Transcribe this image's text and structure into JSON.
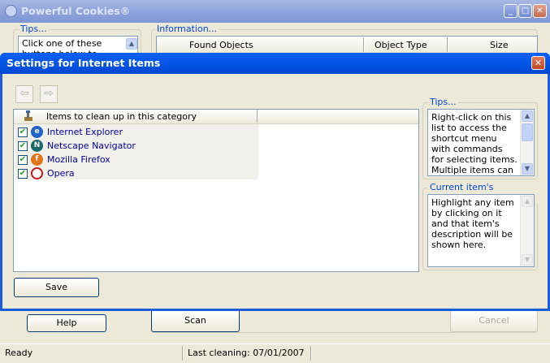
{
  "window": {
    "title": "Powerful Cookies®",
    "icon": "cookie-icon"
  },
  "caption_buttons": {
    "minimize": "_",
    "maximize": "□",
    "close": "✕"
  },
  "main": {
    "tips_label": "Tips...",
    "tips_text": "Click one of these buttons below to",
    "info_label": "Information...",
    "columns": [
      "Found Objects",
      "Object Type",
      "Size"
    ],
    "help_button": "Help",
    "scan_button": "Scan",
    "cancel_button": "Cancel"
  },
  "status": {
    "ready": "Ready",
    "last_cleaning": "Last cleaning: 07/01/2007"
  },
  "dialog": {
    "title": "Settings for Internet Items",
    "close": "✕",
    "back_icon": "arrow-left-icon",
    "forward_icon": "arrow-right-icon",
    "list_header": "Items to clean up in this category",
    "items": [
      {
        "label": "Internet Explorer",
        "checked": true,
        "icon": "internet-explorer-icon",
        "color": "#1f62c8"
      },
      {
        "label": "Netscape Navigator",
        "checked": true,
        "icon": "netscape-icon",
        "color": "#1a6a6a"
      },
      {
        "label": "Mozilla Firefox",
        "checked": true,
        "icon": "firefox-icon",
        "color": "#e2741c"
      },
      {
        "label": "Opera",
        "checked": true,
        "icon": "opera-icon",
        "color": "#c4151b"
      }
    ],
    "tips_label": "Tips...",
    "tips_text": "Right-click on this list to access the shortcut menu with commands for selecting items. Multiple items can be",
    "desc_label": "Current item's description",
    "desc_text": "Highlight any item by clicking on it and that item's description will be shown here.",
    "save_button": "Save"
  },
  "colors": {
    "group_label": "#0046D5",
    "dialog_title": "#0a61f2",
    "item_text": "#00009a"
  }
}
